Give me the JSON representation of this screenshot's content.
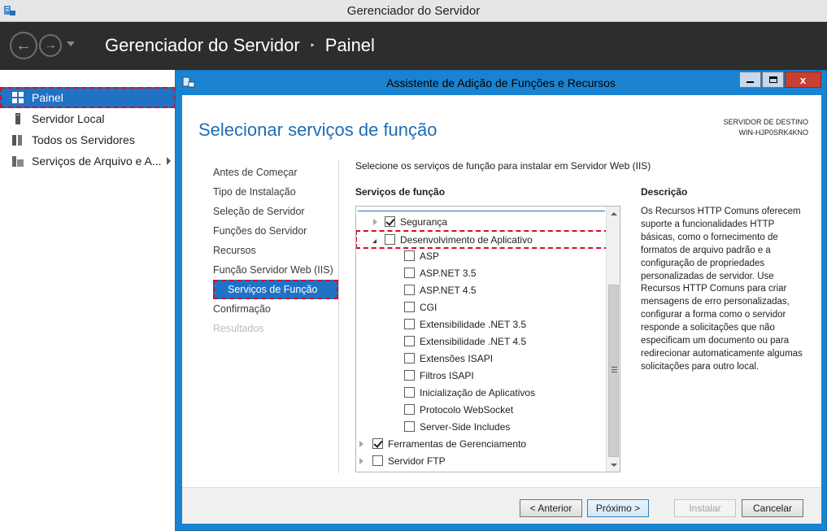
{
  "main_window": {
    "title": "Gerenciador do Servidor"
  },
  "header": {
    "breadcrumb_root": "Gerenciador do Servidor",
    "breadcrumb_separator": "‣",
    "breadcrumb_current": "Painel",
    "back_glyph": "←",
    "forward_glyph": "→"
  },
  "left_nav": {
    "items": [
      {
        "label": "Painel",
        "icon": "dashboard-icon",
        "active": true
      },
      {
        "label": "Servidor Local",
        "icon": "server-icon"
      },
      {
        "label": "Todos os Servidores",
        "icon": "servers-icon"
      },
      {
        "label": "Serviços de Arquivo e A...",
        "icon": "file-services-icon"
      }
    ]
  },
  "dialog": {
    "title": "Assistente de Adição de Funções e Recursos",
    "close_glyph": "x",
    "page_title": "Selecionar serviços de função",
    "destination_label": "SERVIDOR DE DESTINO",
    "destination_server": "WIN-HJP0SRK4KNO",
    "steps": [
      "Antes de Começar",
      "Tipo de Instalação",
      "Seleção de Servidor",
      "Funções do Servidor",
      "Recursos",
      "Função Servidor Web (IIS)",
      "Serviços de Função",
      "Confirmação",
      "Resultados"
    ],
    "current_step_index": 6,
    "disabled_step_index": 8,
    "instruction": "Selecione os serviços de função para instalar em Servidor Web (IIS)",
    "role_services_label": "Serviços de função",
    "tree": [
      {
        "label": "Segurança",
        "checked": true
      },
      {
        "label": "Desenvolvimento de Aplicativo",
        "checked": false
      },
      {
        "label": "ASP",
        "checked": false
      },
      {
        "label": "ASP.NET 3.5",
        "checked": false
      },
      {
        "label": "ASP.NET 4.5",
        "checked": false
      },
      {
        "label": "CGI",
        "checked": false
      },
      {
        "label": "Extensibilidade .NET 3.5",
        "checked": false
      },
      {
        "label": "Extensibilidade .NET 4.5",
        "checked": false
      },
      {
        "label": "Extensões ISAPI",
        "checked": false
      },
      {
        "label": "Filtros ISAPI",
        "checked": false
      },
      {
        "label": "Inicialização de Aplicativos",
        "checked": false
      },
      {
        "label": "Protocolo WebSocket",
        "checked": false
      },
      {
        "label": "Server-Side Includes",
        "checked": false
      },
      {
        "label": "Ferramentas de Gerenciamento",
        "checked": true
      },
      {
        "label": "Servidor FTP",
        "checked": false
      }
    ],
    "description_label": "Descrição",
    "description": "Os Recursos HTTP Comuns oferecem suporte a funcionalidades HTTP básicas, como o fornecimento de formatos de arquivo padrão e a configuração de propriedades personalizadas de servidor. Use Recursos HTTP Comuns para criar mensagens de erro personalizadas, configurar a forma como o servidor responde a solicitações que não especificam um documento ou para redirecionar automaticamente algumas solicitações para outro local.",
    "buttons": {
      "previous": "< Anterior",
      "next": "Próximo >",
      "install": "Instalar",
      "cancel": "Cancelar"
    }
  },
  "colors": {
    "accent": "#1f73c7",
    "dialog_frame": "#1983d1",
    "header_bg": "#2d2d2d",
    "highlight_dash": "#d0102c",
    "page_title": "#1e6db5"
  }
}
